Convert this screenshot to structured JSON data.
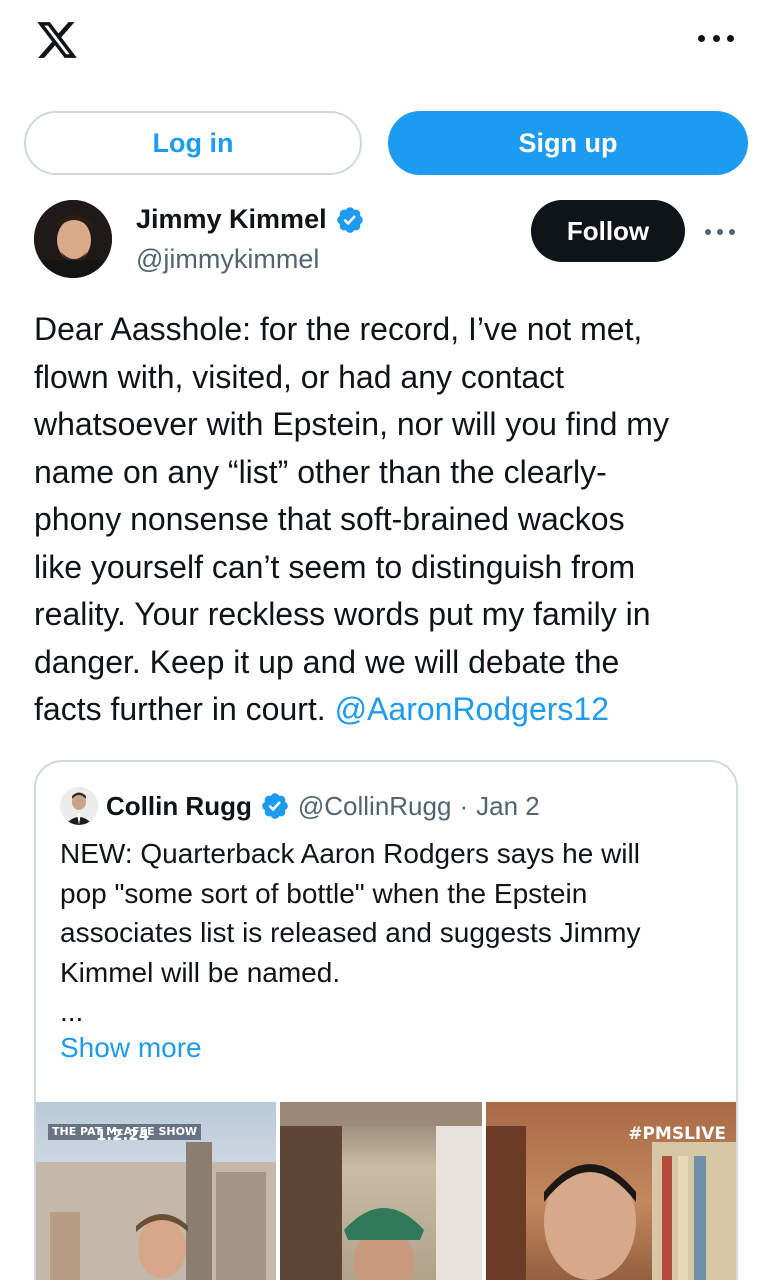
{
  "topbar": {
    "logo_icon": "x-logo-icon",
    "more_icon": "more-horizontal-icon"
  },
  "auth": {
    "login_label": "Log in",
    "signup_label": "Sign up"
  },
  "tweet": {
    "author": {
      "name": "Jimmy Kimmel",
      "handle": "@jimmykimmel",
      "verified": true
    },
    "follow_label": "Follow",
    "text_lines": [
      "Dear Aasshole: for the record, I’ve not met,",
      "flown with, visited, or had any contact",
      "whatsoever with Epstein, nor will you find my",
      "name on any “list” other than the clearly-",
      "phony nonsense that soft-brained wackos",
      "like yourself can’t seem to distinguish from",
      "reality. Your reckless words put my family in",
      "danger. Keep it up and we will debate the",
      "facts further in court."
    ],
    "mention": "@AaronRodgers12"
  },
  "quote": {
    "author_name": "Collin Rugg",
    "handle": "@CollinRugg",
    "separator": "·",
    "date": "Jan 2",
    "text": "NEW: Quarterback Aaron Rodgers says he will\npop \"some sort of bottle\" when the Epstein\nassociates list is released and suggests Jimmy\nKimmel will be named.\n...",
    "show_more": "Show more",
    "media": {
      "overlay_show": "THE PAT McAFEE SHOW",
      "overlay_date": "1.2.24",
      "overlay_tag": "#PMSLIVE"
    }
  },
  "colors": {
    "accent": "#1d9bf0",
    "text": "#0f1419",
    "muted": "#536471",
    "border": "#cfd9de"
  }
}
